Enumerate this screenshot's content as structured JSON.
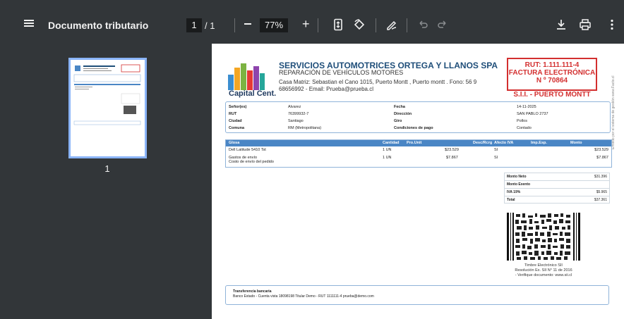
{
  "toolbar": {
    "title": "Documento tributario",
    "page_current": "1",
    "page_total": "/ 1",
    "zoom": "77%",
    "icons": [
      "menu-icon",
      "minus-icon",
      "plus-icon",
      "fit-page-icon",
      "rotate-icon",
      "annotate-icon",
      "undo-icon",
      "redo-icon",
      "download-icon",
      "print-icon",
      "more-icon"
    ]
  },
  "sidebar": {
    "thumb_label": "1"
  },
  "invoice": {
    "company": "SERVICIOS AUTOMOTRICES ORTEGA Y LLANOS SPA",
    "subtitle": "REPARACIÓN DE VEHÍCULOS MOTORES",
    "address1": "Casa Matriz: Sebastian el Cano 1015, Puerto Montt , Puerto montt . Fono: 56 9",
    "address2": "68656992 - Email: Prueba@prueba.cl",
    "logo_text": "Capital Cent.",
    "rut": "RUT: 1.111.111-4",
    "doc_type": "FACTURA ELECTRÓNICA",
    "folio": "N º 70864",
    "sii": "S.I.I. - PUERTO MONTT",
    "side_text": "Emitido por el sistema de gestión www.Facto.cl",
    "info": [
      {
        "l1": "Señor(es)",
        "v1": "Alvarez",
        "l2": "Fecha",
        "v2": "14-11-2025"
      },
      {
        "l1": "RUT",
        "v1": "76399932-7",
        "l2": "Dirección",
        "v2": "SAN PABLO 2737"
      },
      {
        "l1": "Ciudad",
        "v1": "Santiago",
        "l2": "Giro",
        "v2": "Pollos"
      },
      {
        "l1": "Comuna",
        "v1": "RM (Metropolitana)",
        "l2": "Condiciones de pago",
        "v2": "Contado"
      }
    ],
    "headers": [
      "Glosa",
      "Cantidad",
      "Pro.Unit",
      "Desc/Rcrg",
      "Afecto IVA",
      "Imp.Esp.",
      "Monto"
    ],
    "rows": [
      {
        "glosa": "Dell Latitude 5410 Tst",
        "glosa2": "",
        "cant": "1 UN",
        "unit": "$23.529",
        "afecto": "SI",
        "monto": "$23.529"
      },
      {
        "glosa": "Gastos de envío",
        "glosa2": "Costo de envío del pedido",
        "cant": "1 UN",
        "unit": "$7.867",
        "afecto": "SI",
        "monto": "$7.867"
      }
    ],
    "totals": [
      {
        "label": "Monto Neto",
        "value": "$31.396"
      },
      {
        "label": "Monto Exento",
        "value": ""
      },
      {
        "label": "IVA 19%",
        "value": "$5.965"
      },
      {
        "label": "Total",
        "value": "$37.361"
      }
    ],
    "timbre": [
      "Timbre Electrónico SII",
      "Resolución Ex. SII N° 11 de 2016",
      "- Verifique documento: www.sii.cl"
    ],
    "bank_title": "Transferencia bancaria",
    "bank_text": "Banco Estado - Cuenta vista 18098198 Titular Demo - RUT 1111111-4 prueba@demo.com",
    "colors": {
      "accent": "#4a86c5",
      "red": "#d32f2f",
      "title": "#1f4e79"
    }
  }
}
